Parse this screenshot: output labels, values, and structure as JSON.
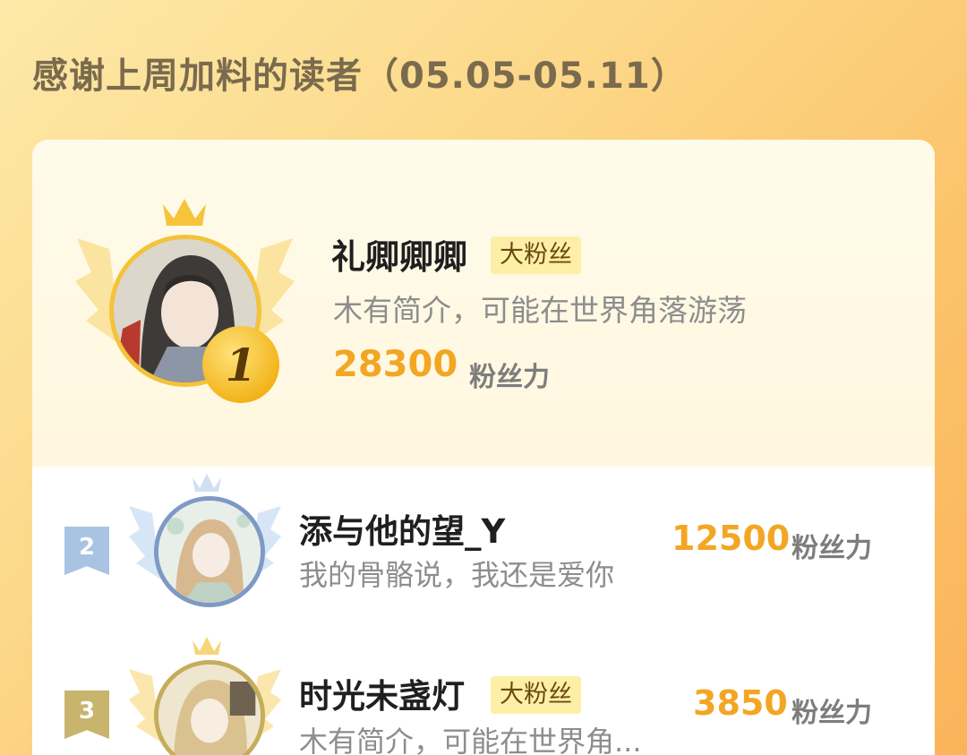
{
  "header": {
    "title": "感谢上周加料的读者（05.05-05.11）"
  },
  "ranking": [
    {
      "rank": "1",
      "name": "礼卿卿卿",
      "tag": "大粉丝",
      "bio": "木有简介，可能在世界角落游荡",
      "score": "28300",
      "score_label": "粉丝力"
    },
    {
      "rank": "2",
      "name": "添与他的望_Y",
      "tag": "",
      "bio": "我的骨骼说，我还是爱你",
      "score": "12500",
      "score_label": "粉丝力"
    },
    {
      "rank": "3",
      "name": "时光未盏灯",
      "tag": "大粉丝",
      "bio": "木有简介，可能在世界角...",
      "score": "3850",
      "score_label": "粉丝力"
    }
  ],
  "colors": {
    "gold": "#f3a623",
    "silver": "#9fb8d8",
    "bronze": "#c8b06a",
    "tag_bg": "#fdf0a6"
  }
}
